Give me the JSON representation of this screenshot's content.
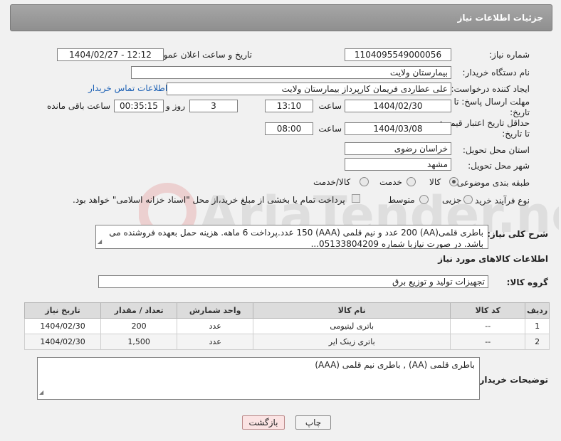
{
  "header": {
    "title": "جزئیات اطلاعات نیاز"
  },
  "fields": {
    "need_number_label": "شماره نیاز:",
    "need_number": "1104095549000056",
    "announce_label": "تاریخ و ساعت اعلان عمومی:",
    "announce_value": "1404/02/27 - 12:12",
    "buyer_org_label": "نام دستگاه خریدار:",
    "buyer_org": "بیمارستان ولایت",
    "creator_label": "ایجاد کننده درخواست:",
    "creator": "علی عطاردی فریمان کارپرداز بیمارستان ولایت",
    "contact_link": "اطلاعات تماس خریدار",
    "reply_deadline_label_1": "مهلت ارسال پاسخ: تا",
    "reply_deadline_label_2": "تاریخ:",
    "reply_date": "1404/02/30",
    "time_label": "ساعت",
    "reply_time": "13:10",
    "days_value": "3",
    "days_label": "روز و",
    "remaining_time": "00:35:15",
    "remaining_label": "ساعت باقی مانده",
    "price_validity_label_1": "حداقل تاریخ اعتبار قیمت:",
    "price_validity_label_2": "تا تاریخ:",
    "price_date": "1404/03/08",
    "price_time": "08:00",
    "province_label": "استان محل تحویل:",
    "province": "خراسان رضوی",
    "city_label": "شهر محل تحویل:",
    "city": "مشهد",
    "category_label": "طبقه بندی موضوعی:",
    "category_options": [
      "کالا",
      "خدمت",
      "کالا/خدمت"
    ],
    "purchase_type_label": "نوع فرآیند خرید :",
    "purchase_options": [
      "جزیی",
      "متوسط"
    ],
    "treasury_text": "پرداخت تمام یا بخشی از مبلغ خرید،از محل \"اسناد خزانه اسلامی\" خواهد بود.",
    "description_label": "شرح کلی نیاز:",
    "description": "باطری قلمی(AA) 200 عدد و نیم قلمی (AAA) 150 عدد.پرداخت 6 ماهه. هزینه حمل بعهده فروشنده می باشد. در صورت نیازبا شماره 05133804209...",
    "goods_info_title": "اطلاعات کالاهای مورد نیاز",
    "goods_group_label": "گروه کالا:",
    "goods_group": "تجهیزات تولید و توزیع برق",
    "buyer_notes_label": "توضیحات خریدار:",
    "buyer_notes": "باطری قلمی (AA) , باطری نیم قلمی (AAA)"
  },
  "table": {
    "headers": [
      "ردیف",
      "کد کالا",
      "نام کالا",
      "واحد شمارش",
      "تعداد / مقدار",
      "تاریخ نیاز"
    ],
    "rows": [
      [
        "1",
        "--",
        "باتری لیتیومی",
        "عدد",
        "200",
        "1404/02/30"
      ],
      [
        "2",
        "--",
        "باتری زینک ایر",
        "عدد",
        "1,500",
        "1404/02/30"
      ]
    ]
  },
  "buttons": {
    "print": "چاپ",
    "back": "بازگشت"
  },
  "watermark_text": "AriaTender.neT"
}
